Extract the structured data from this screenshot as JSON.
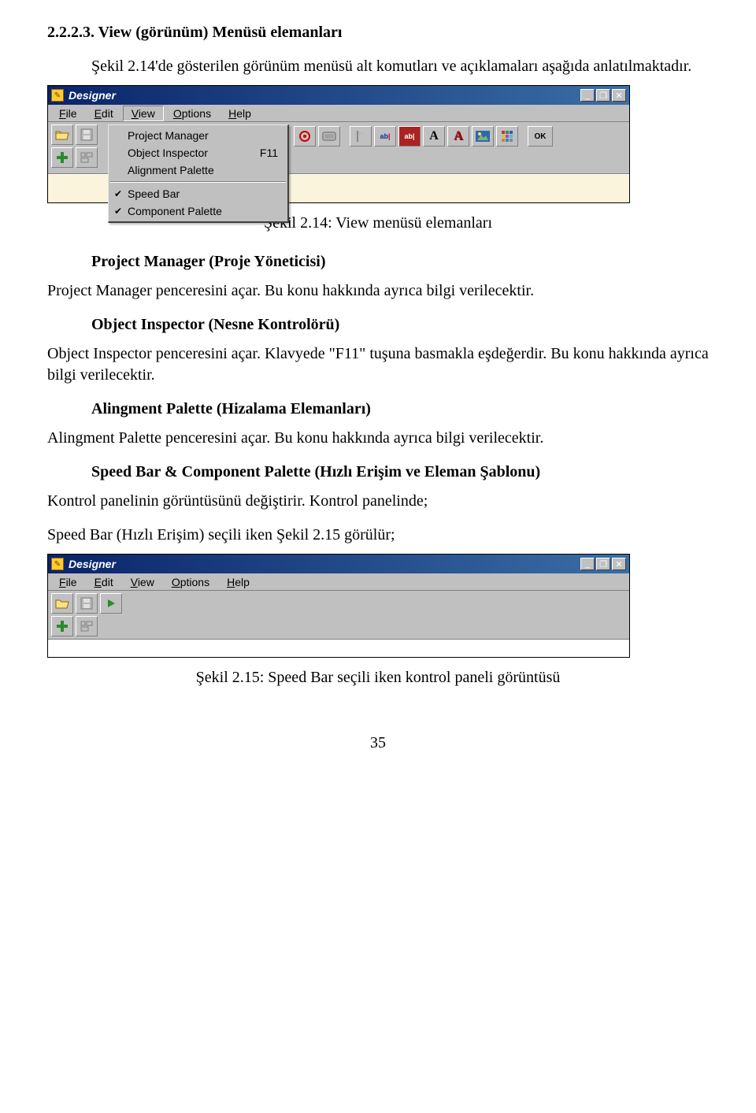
{
  "heading": "2.2.2.3. View (görünüm) Menüsü elemanları",
  "intro_para": "Şekil 2.14'de gösterilen görünüm menüsü alt komutları ve açıklamaları aşağıda anlatılmaktadır.",
  "caption1": "Şekil 2.14: View menüsü elemanları",
  "blocks": [
    {
      "title": "Project Manager (Proje Yöneticisi)",
      "body": "Project Manager penceresini açar. Bu konu hakkında ayrıca bilgi verilecektir."
    },
    {
      "title": "Object Inspector (Nesne Kontrolörü)",
      "body": "Object Inspector penceresini açar. Klavyede \"F11\" tuşuna basmakla eşdeğerdir. Bu konu hakkında ayrıca bilgi verilecektir."
    },
    {
      "title": "Alingment Palette (Hizalama Elemanları)",
      "body": "Alingment Palette penceresini açar. Bu konu hakkında ayrıca bilgi verilecektir."
    },
    {
      "title": "Speed Bar & Component Palette (Hızlı Erişim ve Eleman  Şablonu)",
      "body": "Kontrol panelinin görüntüsünü değiştirir. Kontrol panelinde;"
    }
  ],
  "speedbar_line": "Speed Bar (Hızlı Erişim) seçili iken Şekil 2.15 görülür;",
  "caption2": "Şekil 2.15: Speed Bar seçili iken kontrol paneli görüntüsü",
  "pagenum": "35",
  "win": {
    "title": "Designer",
    "menus": {
      "file": "File",
      "edit": "Edit",
      "view": "View",
      "options": "Options",
      "help": "Help"
    },
    "view_items": {
      "pm": {
        "label": "Project Manager",
        "shortcut": ""
      },
      "oi": {
        "label": "Object Inspector",
        "shortcut": "F11"
      },
      "ap": {
        "label": "Alignment Palette",
        "shortcut": ""
      },
      "sb": {
        "label": "Speed Bar",
        "checked": true
      },
      "cp": {
        "label": "Component Palette",
        "checked": true
      }
    },
    "winbtns": {
      "min": "_",
      "restore": "❐",
      "close": "✕"
    },
    "toolbar_icons": {
      "open": "open-icon",
      "save": "save-icon",
      "run": "run-icon",
      "add": "add-icon",
      "align": "align-icon",
      "target": "target-icon",
      "button3d": "button3d-icon",
      "flag": "flag-icon",
      "abI": "abI",
      "abII": "abII",
      "A": "A",
      "A2": "A",
      "img": "image-icon",
      "grid": "grid-icon",
      "ok": "OK"
    }
  }
}
